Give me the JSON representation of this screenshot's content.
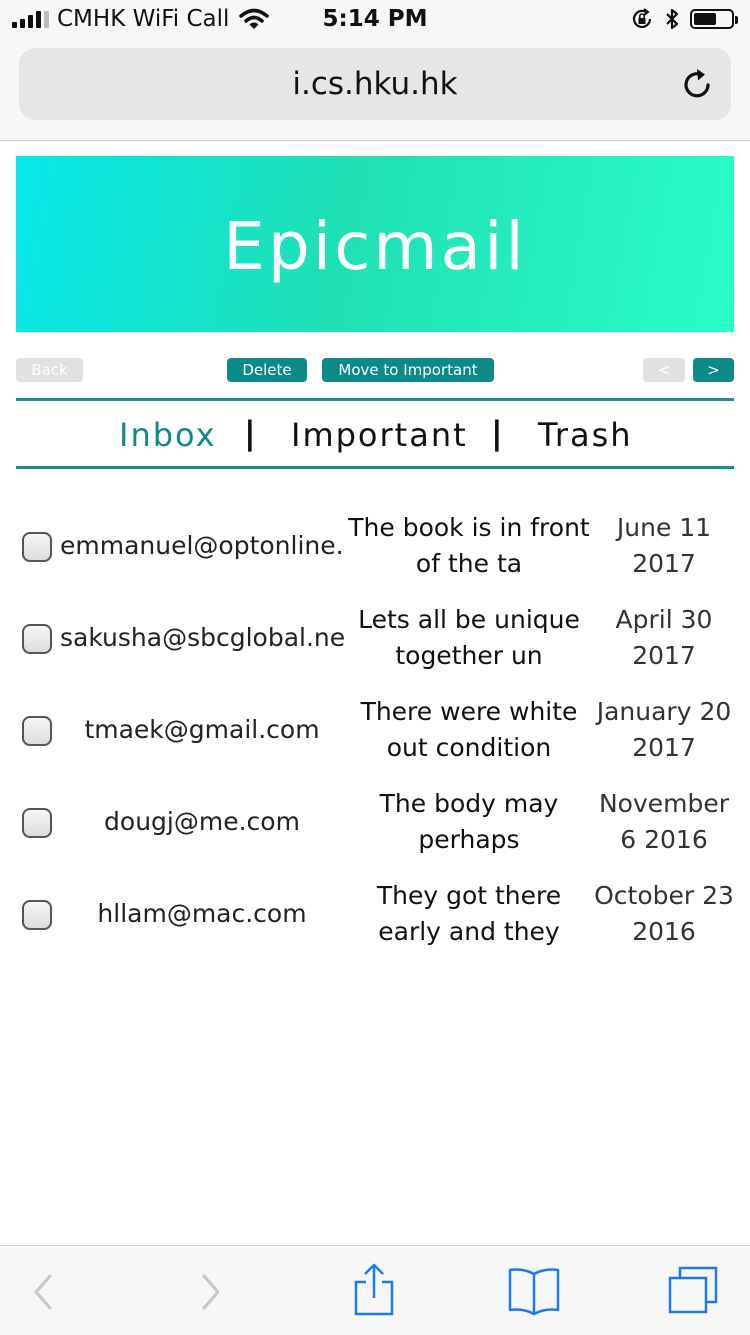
{
  "status_bar": {
    "carrier": "CMHK WiFi Call",
    "time": "5:14 PM",
    "battery_level": 0.6,
    "signal_bars": 4,
    "icons": [
      "signal-icon",
      "wifi-icon",
      "rotation-lock-icon",
      "bluetooth-icon",
      "battery-icon"
    ]
  },
  "browser": {
    "url": "i.cs.hku.hk"
  },
  "banner": {
    "title": "Epicmail"
  },
  "toolbar": {
    "back_label": "Back",
    "delete_label": "Delete",
    "move_label": "Move to Important",
    "prev_label": "<",
    "next_label": ">"
  },
  "tabs": {
    "inbox": "Inbox",
    "important": "Important",
    "trash": "Trash",
    "separator": "|"
  },
  "emails": [
    {
      "from": "emmanuel@optonline.n",
      "subject": "The book is in front of the ta",
      "date": "June 11 2017"
    },
    {
      "from": "sakusha@sbcglobal.ne",
      "subject": "Lets all be unique together un",
      "date": "April 30 2017"
    },
    {
      "from": "tmaek@gmail.com",
      "subject": "There were white out condition",
      "date": "January 20 2017"
    },
    {
      "from": "dougj@me.com",
      "subject": "The body may perhaps",
      "date": "November 6 2016"
    },
    {
      "from": "hllam@mac.com",
      "subject": "They got there early and they",
      "date": "October 23 2016"
    }
  ],
  "colors": {
    "accent": "#0b8a89",
    "banner_start": "#07e8ea",
    "banner_end": "#2afcc8",
    "ios_blue": "#1a7cf5",
    "disabled_gray": "#c7c7cc"
  }
}
